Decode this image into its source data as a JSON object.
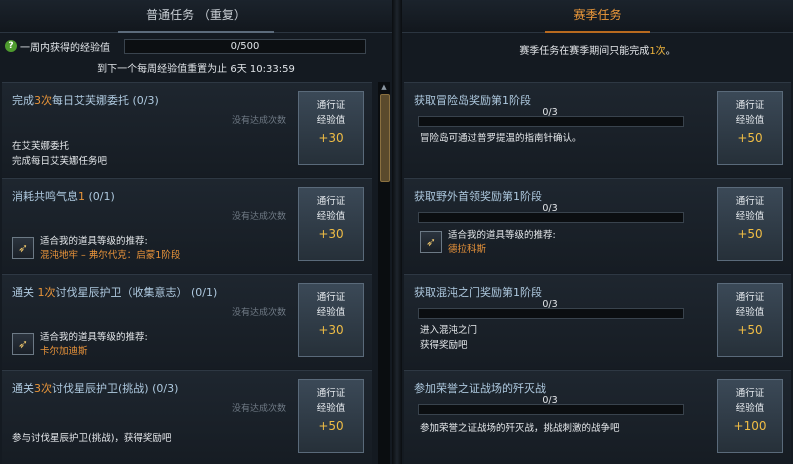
{
  "left": {
    "header": "普通任务 （重复）",
    "weekly_label": "一周内获得的经验值",
    "weekly_progress": "0/500",
    "reset_text": "到下一个每周经验值重置为止 6天 10:33:59",
    "quests": [
      {
        "title_pre": "完成",
        "title_num": "3次",
        "title_post": "每日艾芙娜委托 (0/3)",
        "status": "没有达成次数",
        "desc": [
          "在艾芙娜委托",
          "完成每日艾芙娜任务吧"
        ],
        "reward_line1": "通行证",
        "reward_line2": "经验值",
        "reward_pts": "+30"
      },
      {
        "title_pre": "消耗共鸣气息",
        "title_num": "1",
        "title_post": " (0/1)",
        "status": "没有达成次数",
        "rec_label": "适合我的道具等级的推荐:",
        "rec_item": "混沌地牢 – 弗尔代克：启蒙1阶段",
        "reward_line1": "通行证",
        "reward_line2": "经验值",
        "reward_pts": "+30"
      },
      {
        "title_pre": "通关 ",
        "title_num": "1次",
        "title_post": "讨伐星辰护卫（收集意志） (0/1)",
        "status": "没有达成次数",
        "rec_label": "适合我的道具等级的推荐:",
        "rec_item": "卡尔加迪斯",
        "reward_line1": "通行证",
        "reward_line2": "经验值",
        "reward_pts": "+30"
      },
      {
        "title_pre": "通关",
        "title_num": "3次",
        "title_post": "讨伐星辰护卫(挑战) (0/3)",
        "status": "没有达成次数",
        "desc": [
          "参与讨伐星辰护卫(挑战)，获得奖励吧"
        ],
        "reward_line1": "通行证",
        "reward_line2": "经验值",
        "reward_pts": "+50"
      }
    ]
  },
  "right": {
    "header": "赛季任务",
    "note_pre": "赛季任务在赛季期间只能完成",
    "note_num": "1次",
    "note_post": "。",
    "quests": [
      {
        "title": "获取冒险岛奖励第1阶段",
        "progress": "0/3",
        "desc": [
          "冒险岛可通过普罗提温的指南针确认。"
        ],
        "reward_line1": "通行证",
        "reward_line2": "经验值",
        "reward_pts": "+50"
      },
      {
        "title": "获取野外首领奖励第1阶段",
        "progress": "0/3",
        "rec_label": "适合我的道具等级的推荐:",
        "rec_item": "德拉科斯",
        "reward_line1": "通行证",
        "reward_line2": "经验值",
        "reward_pts": "+50"
      },
      {
        "title": "获取混沌之门奖励第1阶段",
        "progress": "0/3",
        "desc": [
          "进入混沌之门",
          "获得奖励吧"
        ],
        "reward_line1": "通行证",
        "reward_line2": "经验值",
        "reward_pts": "+50"
      },
      {
        "title": "参加荣誉之证战场的歼灭战",
        "progress": "0/3",
        "desc": [
          "参加荣誉之证战场的歼灭战，挑战刺激的战争吧"
        ],
        "reward_line1": "通行证",
        "reward_line2": "经验值",
        "reward_pts": "+100"
      }
    ]
  }
}
